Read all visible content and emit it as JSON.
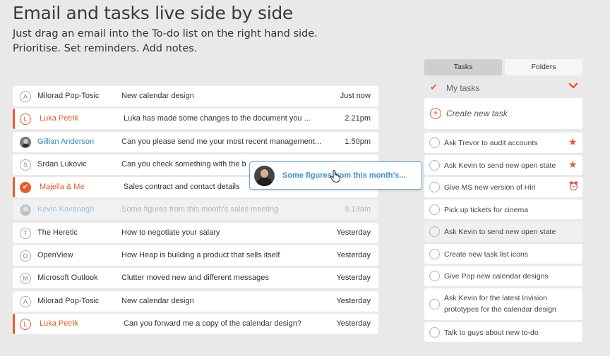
{
  "hero": {
    "title": "Email and tasks live side by side",
    "line1": "Just drag an email into the To-do list on the right hand side.",
    "line2": "Prioritise. Set reminders. Add notes."
  },
  "emails": [
    {
      "avatar": "A",
      "sender": "Milorad Pop-Tosic",
      "subject": "New calendar design",
      "time": "Just now"
    },
    {
      "avatar": "L",
      "sender": "Luka Petrik",
      "subject": "Luka has made some changes to the document you ...",
      "time": "2.21pm"
    },
    {
      "avatar": "",
      "sender": "Gillian Anderson",
      "subject": "Can you please send me your most recent management...",
      "time": "1.50pm"
    },
    {
      "avatar": "S",
      "sender": "Srdan Lukovic",
      "subject": "Can you check something with the b",
      "time": ""
    },
    {
      "avatar": "✔",
      "sender": "Majella & Me",
      "subject": "Sales contract and contact details",
      "time": ""
    },
    {
      "avatar": "",
      "sender": "Kevin Kavanagh",
      "subject": "Some figures from this month's sales meeting",
      "time": "9.13am"
    },
    {
      "avatar": "T",
      "sender": "The Heretic",
      "subject": "How to negotiate your salary",
      "time": "Yesterday"
    },
    {
      "avatar": "O",
      "sender": "OpenView",
      "subject": "How Heap is building a product that sells itself",
      "time": "Yesterday"
    },
    {
      "avatar": "M",
      "sender": "Microsoft Outlook",
      "subject": "Clutter moved new and different messages",
      "time": "Yesterday"
    },
    {
      "avatar": "A",
      "sender": "Milorad Pop-Tosic",
      "subject": "New calendar design",
      "time": "Yesterday"
    },
    {
      "avatar": "L",
      "sender": "Luka Petrik",
      "subject": "Can you forward me a copy of the calendar design?",
      "time": "Yesterday"
    }
  ],
  "drag": {
    "text": "Some figures from this month's..."
  },
  "panel": {
    "tab_tasks": "Tasks",
    "tab_folders": "Folders",
    "list_title": "My tasks",
    "create_label": "Create new task"
  },
  "tasks": [
    {
      "label": "Ask Trevor to audit accounts",
      "flag": "star-icon"
    },
    {
      "label": "Ask Kevin to send new open state",
      "flag": "star-icon"
    },
    {
      "label": "Give MS new version of Hiri",
      "flag": "alarm-icon"
    },
    {
      "label": "Pick up tickets for cinema",
      "flag": ""
    },
    {
      "label": "Ask Kevin to send new open state",
      "flag": ""
    },
    {
      "label": "Create new task list icons",
      "flag": ""
    },
    {
      "label": "Give Pop new calendar designs",
      "flag": ""
    },
    {
      "label": "Ask Kevin for the latest Invision prototypes for the calendar design",
      "flag": ""
    },
    {
      "label": "Talk to guys about new to-do",
      "flag": ""
    }
  ],
  "colors": {
    "accent": "#ea5a2b",
    "link_blue": "#2d86c4",
    "drag_border": "#6aa7de"
  }
}
